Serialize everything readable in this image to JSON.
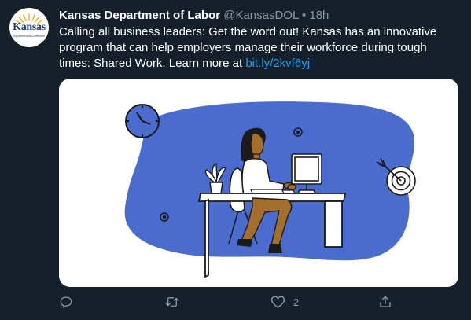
{
  "tweet": {
    "author": {
      "name": "Kansas Department of Labor",
      "handle": "@KansasDOL",
      "logo_word": "Kansas",
      "logo_sub": "Department of Commerce"
    },
    "separator": "•",
    "time": "18h",
    "text": "Calling all business leaders: Get the word out! Kansas has an innovative program that can help employers manage their workforce during tough times: Shared Work. Learn more at ",
    "link": "bit.ly/2kvf6yj",
    "actions": {
      "reply_count": "",
      "retweet_count": "",
      "like_count": "2",
      "share_count": ""
    },
    "colors": {
      "background": "#15202b",
      "secondary_text": "#8899a6",
      "link": "#1da1f2",
      "illustration_blue": "#4b6ccf",
      "illustration_skin": "#a46f2c"
    }
  }
}
